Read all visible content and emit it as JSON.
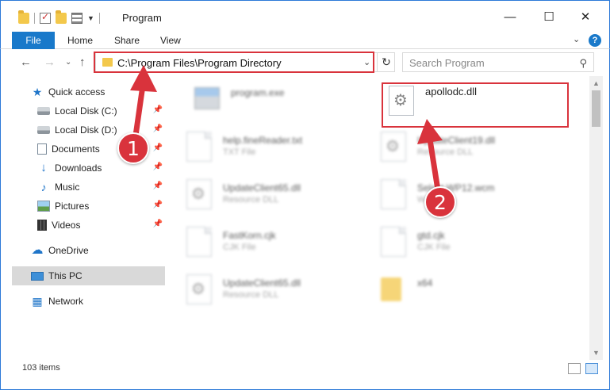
{
  "window": {
    "title": "Program"
  },
  "ribbon": {
    "tabs": [
      "File",
      "Home",
      "Share",
      "View"
    ]
  },
  "address": {
    "path": "C:\\Program Files\\Program Directory"
  },
  "search": {
    "placeholder": "Search Program"
  },
  "sidebar": {
    "quick_access": "Quick access",
    "items": [
      {
        "label": "Local Disk (C:)",
        "icon": "disk-icon",
        "pinned": true
      },
      {
        "label": "Local Disk (D:)",
        "icon": "disk-icon",
        "pinned": true
      },
      {
        "label": "Documents",
        "icon": "document-icon",
        "pinned": true
      },
      {
        "label": "Downloads",
        "icon": "download-icon",
        "pinned": true
      },
      {
        "label": "Music",
        "icon": "music-icon",
        "pinned": true
      },
      {
        "label": "Pictures",
        "icon": "pictures-icon",
        "pinned": true
      },
      {
        "label": "Videos",
        "icon": "videos-icon",
        "pinned": true
      }
    ],
    "onedrive": "OneDrive",
    "this_pc": "This PC",
    "network": "Network"
  },
  "files": [
    {
      "name": "program.exe",
      "type": "",
      "icon": "exe-icon"
    },
    {
      "name": "apollodc.dll",
      "type": "",
      "icon": "dll-gear-icon"
    },
    {
      "name": "help.fineReader.txt",
      "type": "TXT File",
      "icon": "text-file-icon"
    },
    {
      "name": "UpdateClient19.dll",
      "type": "Resource DLL",
      "icon": "dll-gear-icon"
    },
    {
      "name": "UpdateClient65.dll",
      "type": "Resource DLL",
      "icon": "dll-gear-icon"
    },
    {
      "name": "Select WP12.wcm",
      "type": "WCM File",
      "icon": "file-icon"
    },
    {
      "name": "FastKorn.cjk",
      "type": "CJK File",
      "icon": "file-icon"
    },
    {
      "name": "gtd.cjk",
      "type": "CJK File",
      "icon": "file-icon"
    },
    {
      "name": "UpdateClient65.dll",
      "type": "Resource DLL",
      "icon": "dll-gear-icon"
    },
    {
      "name": "x64",
      "type": "",
      "icon": "folder-icon"
    }
  ],
  "status": {
    "items": "103 items"
  },
  "annotations": {
    "step1": "1",
    "step2": "2"
  },
  "colors": {
    "accent": "#1979ca",
    "highlight": "#d9333c",
    "window_border": "#2b79d8"
  }
}
